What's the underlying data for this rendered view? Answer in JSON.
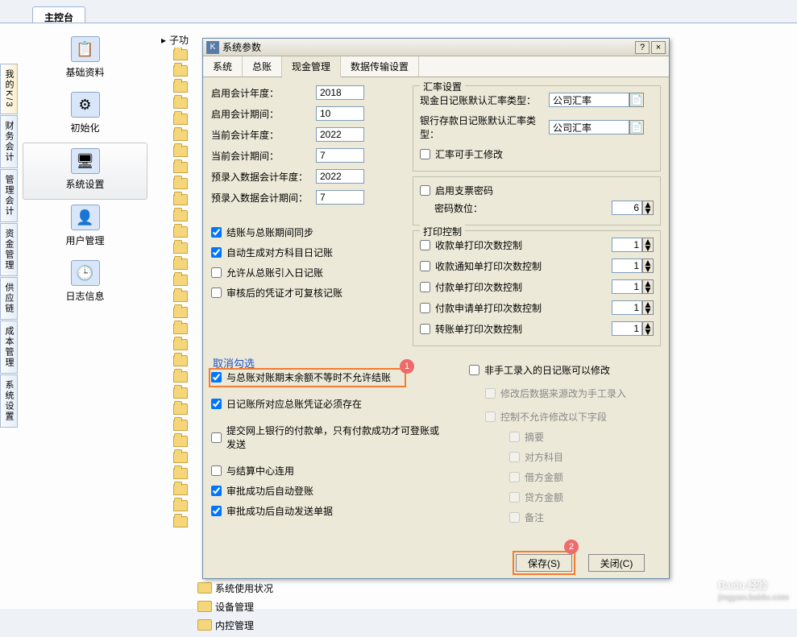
{
  "main_tab": "主控台",
  "side_tabs": [
    "我的K/3",
    "财务会计",
    "管理会计",
    "资金管理",
    "供应链",
    "成本管理",
    "系统设置"
  ],
  "nav": [
    {
      "label": "基础资料",
      "icon": "📋"
    },
    {
      "label": "初始化",
      "icon": "⚙"
    },
    {
      "label": "系统设置",
      "icon": "🖥"
    },
    {
      "label": "用户管理",
      "icon": "👤"
    },
    {
      "label": "日志信息",
      "icon": "🕒"
    }
  ],
  "tree_root": "子功",
  "bottom_items": [
    "系统使用状况",
    "设备管理",
    "内控管理"
  ],
  "dialog": {
    "title": "系统参数",
    "help": "?",
    "close": "×",
    "tabs": [
      "系统",
      "总账",
      "现金管理",
      "数据传输设置"
    ],
    "fields": {
      "f1": {
        "label": "启用会计年度：",
        "val": "2018"
      },
      "f2": {
        "label": "启用会计期间：",
        "val": "10"
      },
      "f3": {
        "label": "当前会计年度：",
        "val": "2022"
      },
      "f4": {
        "label": "当前会计期间：",
        "val": "7"
      },
      "f5": {
        "label": "预录入数据会计年度：",
        "val": "2022"
      },
      "f6": {
        "label": "预录入数据会计期间：",
        "val": "7"
      }
    },
    "rate_group": {
      "legend": "汇率设置",
      "r1_label": "现金日记账默认汇率类型：",
      "r1_val": "公司汇率",
      "r2_label": "银行存款日记账默认汇率类型：",
      "r2_val": "公司汇率",
      "manual": "汇率可手工修改"
    },
    "cheque": {
      "enable": "启用支票密码",
      "digits_label": "密码数位：",
      "digits": "6"
    },
    "print": {
      "legend": "打印控制",
      "p1": "收款单打印次数控制",
      "p2": "收款通知单打印次数控制",
      "p3": "付款单打印次数控制",
      "p4": "付款申请单打印次数控制",
      "p5": "转账单打印次数控制",
      "default": "1"
    },
    "checks": {
      "c1": "结账与总账期间同步",
      "c2": "自动生成对方科目日记账",
      "c3": "允许从总账引入日记账",
      "c4": "审核后的凭证才可复核记账",
      "c5": "与总账对账期末余额不等时不允许结账",
      "c6": "日记账所对应总账凭证必须存在",
      "c7": "提交网上银行的付款单，只有付款成功才可登账或发送",
      "c8": "与结算中心连用",
      "c9": "审批成功后自动登账",
      "c10": "审批成功后自动发送单据"
    },
    "right_checks": {
      "r1": "非手工录入的日记账可以修改",
      "r2": "修改后数据来源改为手工录入",
      "r3": "控制不允许修改以下字段",
      "s1": "摘要",
      "s2": "对方科目",
      "s3": "借方金额",
      "s4": "贷方金额",
      "s5": "备注"
    },
    "annotation": "取消勾选",
    "badge1": "1",
    "badge2": "2",
    "buttons": {
      "save": "保存(S)",
      "close": "关闭(C)"
    }
  },
  "watermark": {
    "brand": "Baidu 经验",
    "sub": "jingyan.baidu.com"
  }
}
